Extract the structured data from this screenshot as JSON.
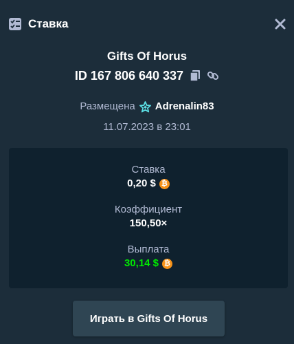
{
  "header": {
    "title": "Ставка",
    "close_symbol": "✕",
    "icon": "bet-slip-icon"
  },
  "game": {
    "title": "Gifts Of Horus",
    "bet_id": "ID 167 806 640 337"
  },
  "placed": {
    "label": "Размещена",
    "username": "Adrenalin83",
    "date": "11.07.2023 в 23:01"
  },
  "stats": {
    "bet_label": "Ставка",
    "bet_value": "0,20 $",
    "multiplier_label": "Коэффициент",
    "multiplier_value": "150,50×",
    "payout_label": "Выплата",
    "payout_value": "30,14 $",
    "currency_symbol": "₿"
  },
  "play_button": {
    "label": "Играть в Gifts Of Horus"
  },
  "colors": {
    "background": "#1c2d3a",
    "panel": "#0f212e",
    "button": "#2f4553",
    "muted_text": "#b1bad3",
    "payout_green": "#00e701",
    "coin_orange": "#f7931a"
  }
}
